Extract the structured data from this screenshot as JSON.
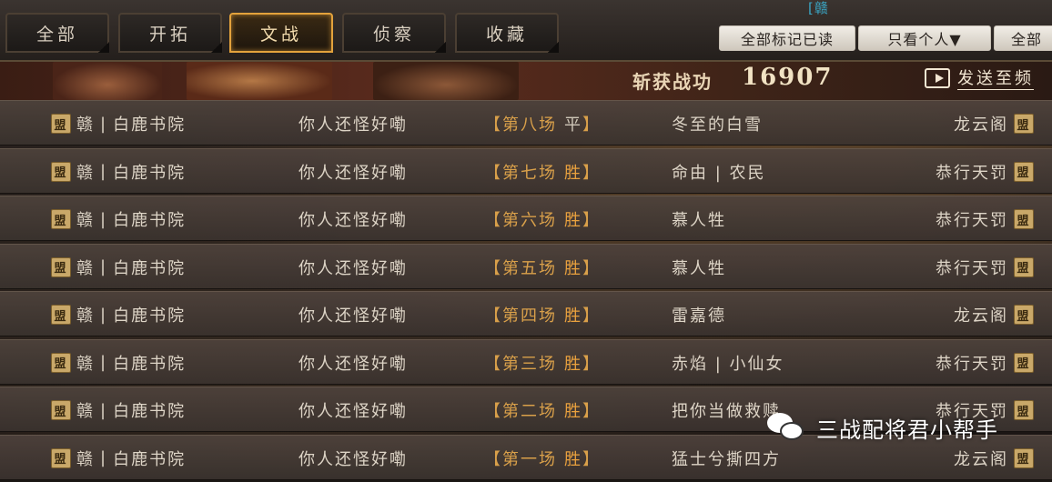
{
  "header": {
    "tabs": [
      {
        "label": "全部",
        "active": false
      },
      {
        "label": "开拓",
        "active": false
      },
      {
        "label": "文战",
        "active": true
      },
      {
        "label": "侦察",
        "active": false
      },
      {
        "label": "收藏",
        "active": false
      }
    ],
    "top_code": "[赣",
    "buttons": {
      "mark_all_read": "全部标记已读",
      "filter_personal": "只看个人▼",
      "all": "全部"
    }
  },
  "banner": {
    "score_label": "斩获战功",
    "score_value": "16907",
    "send_label": "发送至频"
  },
  "rows": [
    {
      "alliance": "赣",
      "group": "白鹿书院",
      "player": "你人还怪好嘞",
      "battle": "第八场",
      "result": "平",
      "result_type": "draw",
      "opponent": "冬至的白雪",
      "opp_group": "龙云阁",
      "seal": "盟"
    },
    {
      "alliance": "赣",
      "group": "白鹿书院",
      "player": "你人还怪好嘞",
      "battle": "第七场",
      "result": "胜",
      "result_type": "win",
      "opponent": "命由 | 农民",
      "opp_group": "恭行天罚",
      "seal": "盟"
    },
    {
      "alliance": "赣",
      "group": "白鹿书院",
      "player": "你人还怪好嘞",
      "battle": "第六场",
      "result": "胜",
      "result_type": "win",
      "opponent": "慕人牲",
      "opp_group": "恭行天罚",
      "seal": "盟"
    },
    {
      "alliance": "赣",
      "group": "白鹿书院",
      "player": "你人还怪好嘞",
      "battle": "第五场",
      "result": "胜",
      "result_type": "win",
      "opponent": "慕人牲",
      "opp_group": "恭行天罚",
      "seal": "盟"
    },
    {
      "alliance": "赣",
      "group": "白鹿书院",
      "player": "你人还怪好嘞",
      "battle": "第四场",
      "result": "胜",
      "result_type": "win",
      "opponent": "雷嘉德",
      "opp_group": "龙云阁",
      "seal": "盟"
    },
    {
      "alliance": "赣",
      "group": "白鹿书院",
      "player": "你人还怪好嘞",
      "battle": "第三场",
      "result": "胜",
      "result_type": "win",
      "opponent": "赤焰 | 小仙女",
      "opp_group": "恭行天罚",
      "seal": "盟"
    },
    {
      "alliance": "赣",
      "group": "白鹿书院",
      "player": "你人还怪好嘞",
      "battle": "第二场",
      "result": "胜",
      "result_type": "win",
      "opponent": "把你当做救赎",
      "opp_group": "恭行天罚",
      "seal": "盟"
    },
    {
      "alliance": "赣",
      "group": "白鹿书院",
      "player": "你人还怪好嘞",
      "battle": "第一场",
      "result": "胜",
      "result_type": "win",
      "opponent": "猛士兮撕四方",
      "opp_group": "龙云阁",
      "seal": "盟"
    }
  ],
  "watermark": {
    "text": "三战配将君小帮手"
  },
  "colors": {
    "accent": "#e3a23c",
    "win": "#e9a13e",
    "text": "#ddd4c6"
  }
}
